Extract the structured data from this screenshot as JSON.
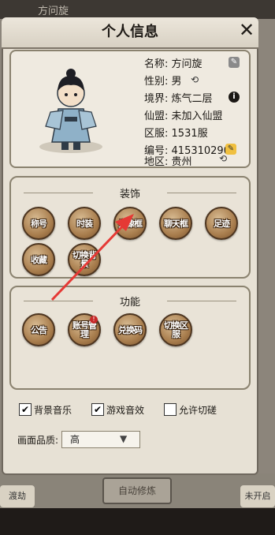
{
  "background": {
    "top_name": "方问旋",
    "bottom_button": "自动修炼",
    "left_tag": "渡劫",
    "right_tag": "未开启"
  },
  "dialog": {
    "title": "个人信息",
    "close_icon": "close-x-icon"
  },
  "profile": {
    "name_label": "名称:",
    "name_value": "方问旋",
    "gender_label": "性别:",
    "gender_value": "男",
    "realm_label": "境界:",
    "realm_value": "炼气二层",
    "sect_label": "仙盟:",
    "sect_value": "未加入仙盟",
    "server_label": "区服:",
    "server_value": "1531服",
    "id_label": "编号:",
    "id_value": "415310290",
    "region_label": "地区:",
    "region_value": "贵州"
  },
  "decoration": {
    "title": "装饰",
    "items": [
      "称号",
      "时装",
      "头像框",
      "聊天框",
      "足迹",
      "收藏",
      "切换背景"
    ]
  },
  "functions": {
    "title": "功能",
    "items": [
      "公告",
      "账号管理",
      "兑换码",
      "切换区服"
    ],
    "notice_badge": "!"
  },
  "settings": {
    "bgm_label": "背景音乐",
    "bgm_checked": true,
    "sfx_label": "游戏音效",
    "sfx_checked": true,
    "spar_label": "允许切磋",
    "spar_checked": false,
    "quality_label": "画面品质:",
    "quality_value": "高"
  },
  "colors": {
    "panel_bg": "#e7e1d5",
    "badge_brown": "#a97e4e",
    "annotation_arrow": "#e53935"
  }
}
